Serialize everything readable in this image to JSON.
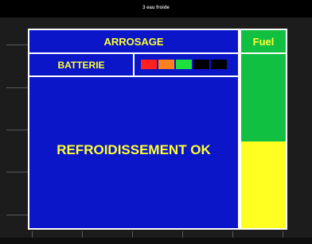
{
  "window": {
    "title": "3 eau froide"
  },
  "main": {
    "header_label": "ARROSAGE",
    "battery_label": "BATTERIE",
    "status_text": "REFROIDISSEMENT OK"
  },
  "battery_segments": [
    {
      "color": "#ff2020"
    },
    {
      "color": "#ff8020"
    },
    {
      "color": "#20e040"
    },
    {
      "color": "#000000"
    },
    {
      "color": "#000000"
    }
  ],
  "fuel": {
    "label": "Fuel",
    "level_fraction": 0.5,
    "fill_color": "#ffff22",
    "empty_color": "#11c040"
  },
  "colors": {
    "panel_blue": "#0a16c8",
    "text_yellow": "#ffff33",
    "border_white": "#ffffff"
  }
}
